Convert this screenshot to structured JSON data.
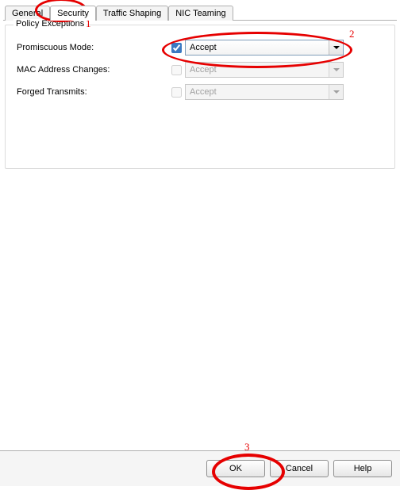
{
  "tabs": {
    "general": "General",
    "security": "Security",
    "traffic_shaping": "Traffic Shaping",
    "nic_teaming": "NIC Teaming"
  },
  "panel": {
    "title": "Policy Exceptions",
    "rows": {
      "promiscuous": {
        "label": "Promiscuous Mode:",
        "checked": true,
        "value": "Accept",
        "enabled": true
      },
      "mac": {
        "label": "MAC Address Changes:",
        "checked": false,
        "value": "Accept",
        "enabled": false
      },
      "forged": {
        "label": "Forged Transmits:",
        "checked": false,
        "value": "Accept",
        "enabled": false
      }
    }
  },
  "buttons": {
    "ok": "OK",
    "cancel": "Cancel",
    "help": "Help"
  },
  "annotations": {
    "one": "1",
    "two": "2",
    "three": "3"
  }
}
